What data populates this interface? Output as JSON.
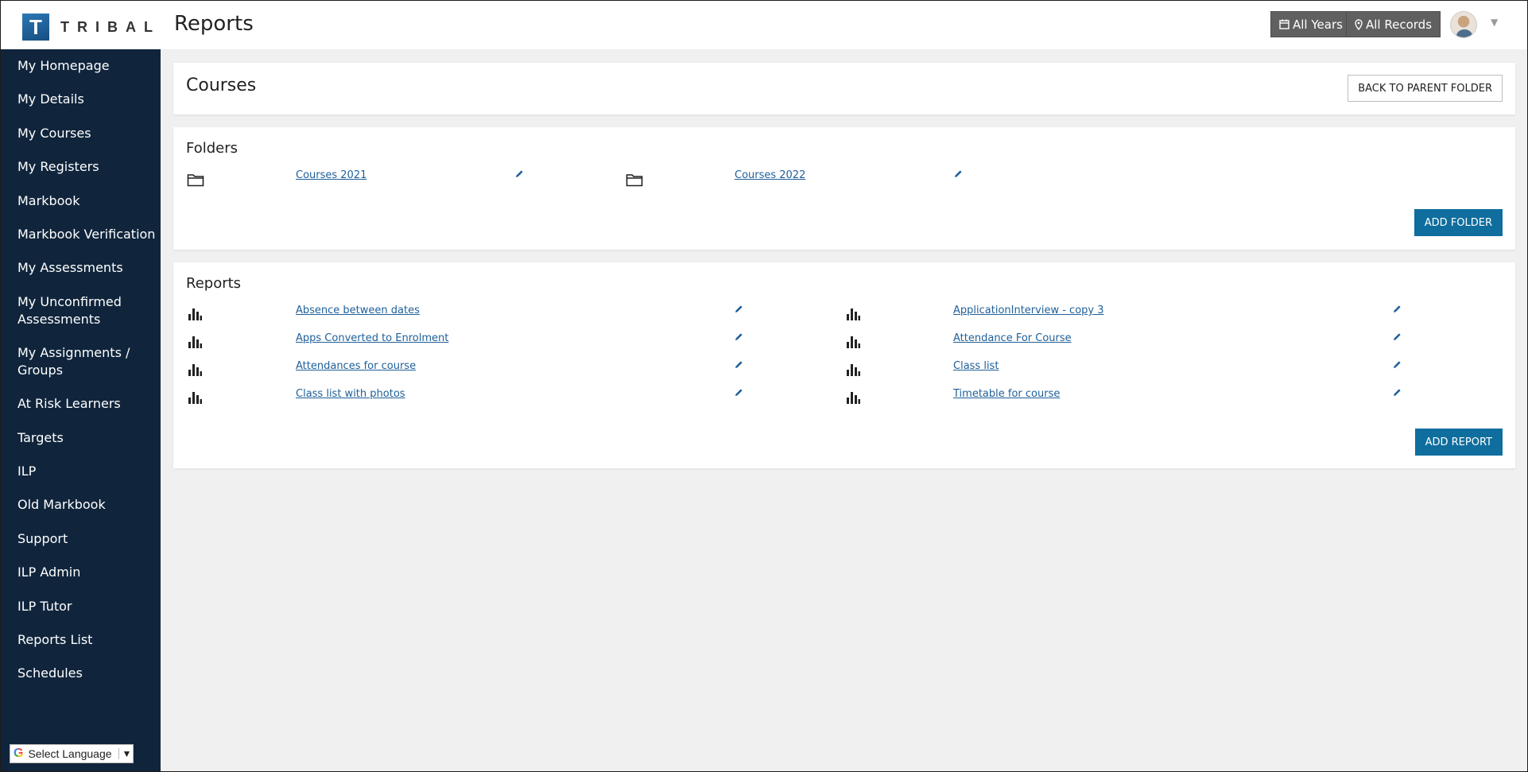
{
  "header": {
    "logo_letter": "T",
    "logo_text": "TRIBAL",
    "page_title": "Reports",
    "all_years_label": "All Years",
    "all_records_label": "All Records"
  },
  "sidebar": {
    "items": [
      {
        "label": "My Homepage"
      },
      {
        "label": "My Details"
      },
      {
        "label": "My Courses"
      },
      {
        "label": "My Registers"
      },
      {
        "label": "Markbook"
      },
      {
        "label": "Markbook Verification"
      },
      {
        "label": "My Assessments"
      },
      {
        "label": "My Unconfirmed Assessments"
      },
      {
        "label": "My Assignments / Groups"
      },
      {
        "label": "At Risk Learners"
      },
      {
        "label": "Targets"
      },
      {
        "label": "ILP"
      },
      {
        "label": "Old Markbook"
      },
      {
        "label": "Support"
      },
      {
        "label": "ILP Admin"
      },
      {
        "label": "ILP Tutor"
      },
      {
        "label": "Reports List"
      },
      {
        "label": "Schedules"
      }
    ],
    "language_label": "Select Language"
  },
  "courses_panel": {
    "title": "Courses",
    "back_button": "BACK TO PARENT FOLDER"
  },
  "folders_panel": {
    "title": "Folders",
    "items": [
      {
        "label": "Courses 2021"
      },
      {
        "label": "Courses 2022"
      }
    ],
    "add_button": "ADD FOLDER"
  },
  "reports_panel": {
    "title": "Reports",
    "items": [
      {
        "label": "Absence between dates"
      },
      {
        "label": "ApplicationInterview - copy 3"
      },
      {
        "label": "Apps Converted to Enrolment"
      },
      {
        "label": "Attendance For Course"
      },
      {
        "label": "Attendances for course"
      },
      {
        "label": "Class list"
      },
      {
        "label": "Class list with photos"
      },
      {
        "label": "Timetable for course"
      }
    ],
    "add_button": "ADD REPORT"
  },
  "colors": {
    "sidebar_bg": "#10253c",
    "primary_button": "#0f6e9d",
    "link": "#1f5f99",
    "header_button": "#606060"
  },
  "icons": {
    "folder": "folder-icon",
    "report": "bar-chart-icon",
    "edit": "pencil-icon",
    "calendar": "calendar-icon",
    "location": "map-marker-icon"
  }
}
